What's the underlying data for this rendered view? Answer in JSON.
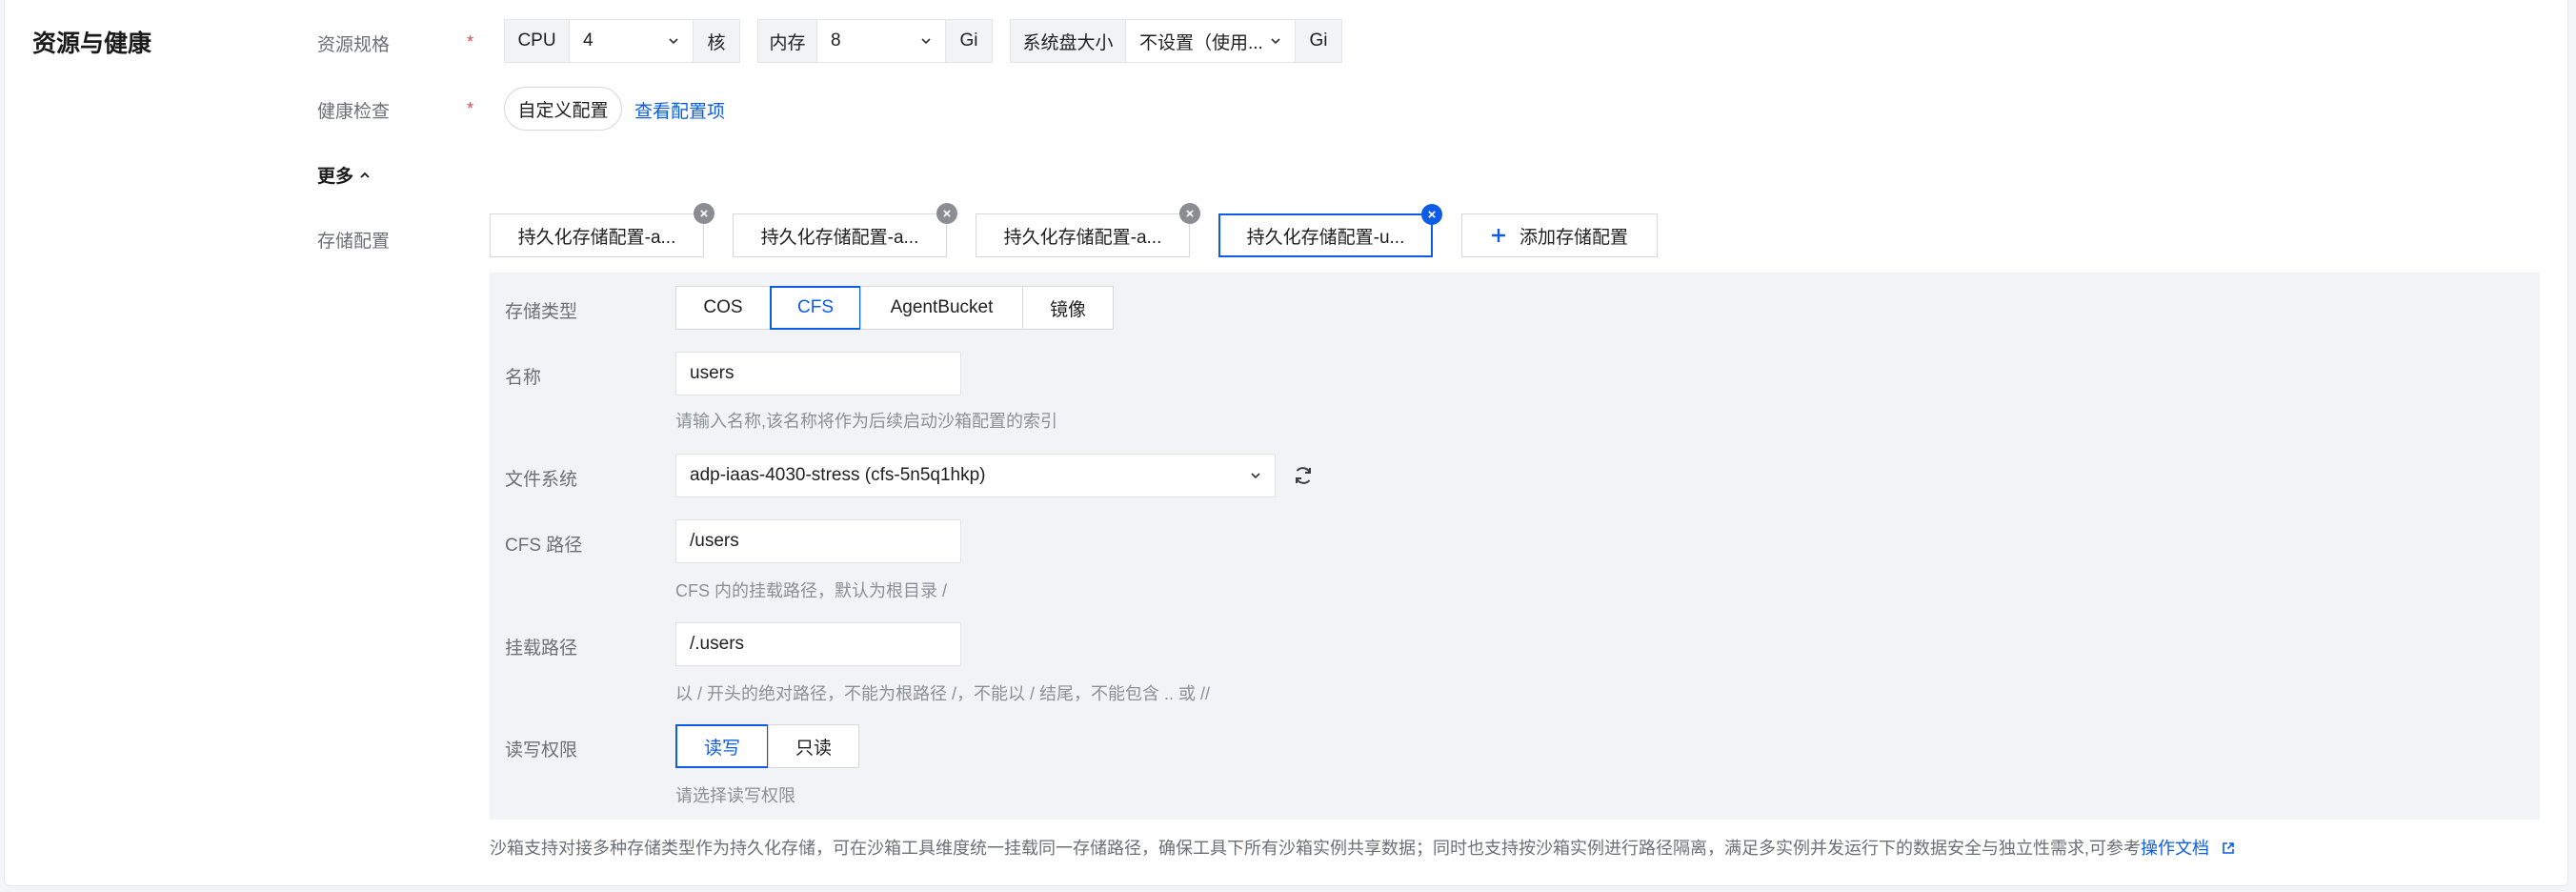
{
  "section_title": "资源与健康",
  "resource": {
    "label": "资源规格",
    "cpu_label": "CPU",
    "cpu_value": "4",
    "cpu_unit": "核",
    "mem_label": "内存",
    "mem_value": "8",
    "mem_unit": "Gi",
    "disk_label": "系统盘大小",
    "disk_value": "不设置（使用...",
    "disk_unit": "Gi"
  },
  "required_mark": "*",
  "health": {
    "label": "健康检查",
    "custom_button": "自定义配置",
    "view_link": "查看配置项"
  },
  "more": {
    "label": "更多"
  },
  "storage": {
    "label": "存储配置",
    "tabs": [
      {
        "label": "持久化存储配置-a...",
        "active": false
      },
      {
        "label": "持久化存储配置-a...",
        "active": false
      },
      {
        "label": "持久化存储配置-a...",
        "active": false
      },
      {
        "label": "持久化存储配置-u...",
        "active": true
      }
    ],
    "add_label": "添加存储配置"
  },
  "panel": {
    "type_label": "存储类型",
    "types": [
      {
        "label": "COS",
        "active": false
      },
      {
        "label": "CFS",
        "active": true
      },
      {
        "label": "AgentBucket",
        "active": false
      },
      {
        "label": "镜像",
        "active": false
      }
    ],
    "name_label": "名称",
    "name_value": "users",
    "name_help": "请输入名称,该名称将作为后续启动沙箱配置的索引",
    "fs_label": "文件系统",
    "fs_value": "adp-iaas-4030-stress (cfs-5n5q1hkp)",
    "cfs_path_label": "CFS 路径",
    "cfs_path_value": "/users",
    "cfs_path_help": "CFS 内的挂载路径，默认为根目录 /",
    "mount_label": "挂载路径",
    "mount_value": "/.users",
    "mount_help": "以 / 开头的绝对路径，不能为根路径 /，不能以 / 结尾，不能包含 .. 或 //",
    "perm_label": "读写权限",
    "perm_options": [
      {
        "label": "读写",
        "active": true
      },
      {
        "label": "只读",
        "active": false
      }
    ],
    "perm_help": "请选择读写权限"
  },
  "footer": {
    "note": "沙箱支持对接多种存储类型作为持久化存储，可在沙箱工具维度统一挂载同一存储路径，确保工具下所有沙箱实例共享数据；同时也支持按沙箱实例进行路径隔离，满足多实例并发运行下的数据安全与独立性需求,可参考",
    "doc_link": "操作文档"
  },
  "colors": {
    "accent": "#0d5ce5",
    "required": "#e5484d",
    "panel_bg": "#f2f3f6"
  }
}
